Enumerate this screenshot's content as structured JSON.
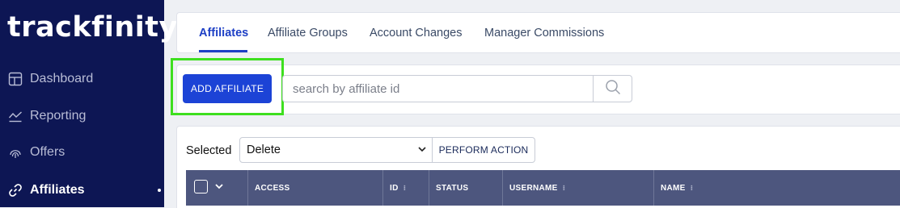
{
  "brand": {
    "logo_text": "trackfinity"
  },
  "sidebar": {
    "items": [
      {
        "label": "Dashboard",
        "icon": "dashboard-icon",
        "active": false
      },
      {
        "label": "Reporting",
        "icon": "chart-line-icon",
        "active": false
      },
      {
        "label": "Offers",
        "icon": "fingerprint-icon",
        "active": false
      },
      {
        "label": "Affiliates",
        "icon": "link-icon",
        "active": true
      }
    ]
  },
  "tabs": [
    {
      "label": "Affiliates",
      "active": true
    },
    {
      "label": "Affiliate Groups",
      "active": false
    },
    {
      "label": "Account Changes",
      "active": false
    },
    {
      "label": "Manager Commissions",
      "active": false
    }
  ],
  "toolbar": {
    "add_label": "ADD AFFILIATE",
    "search_placeholder": "search by affiliate id",
    "search_icon": "search-icon"
  },
  "bulk": {
    "selected_label": "Selected",
    "action_value": "Delete",
    "perform_label": "PERFORM ACTION"
  },
  "table": {
    "headers": [
      "ACCESS",
      "ID",
      "STATUS",
      "USERNAME",
      "NAME"
    ]
  },
  "colors": {
    "sidebar_bg": "#0d1654",
    "accent": "#1c43d6",
    "table_header_bg": "#4d567e",
    "highlight": "#3edf1f"
  }
}
